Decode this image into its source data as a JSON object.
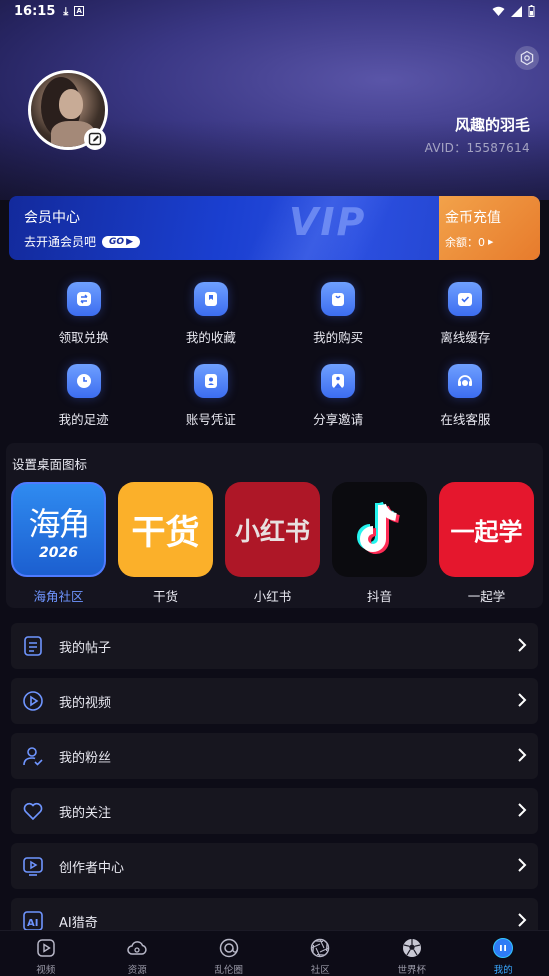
{
  "status_bar": {
    "time": "16:15"
  },
  "profile": {
    "nickname": "风趣的羽毛",
    "avid": "AVID：15587614"
  },
  "vip": {
    "title": "会员中心",
    "subtitle": "去开通会员吧",
    "go_label": "GO",
    "banner_word": "VIP"
  },
  "coins": {
    "title": "金币充值",
    "balance": "余额：0"
  },
  "functions": [
    {
      "label": "领取兑换",
      "icon": "exchange-icon"
    },
    {
      "label": "我的收藏",
      "icon": "bookmark-icon"
    },
    {
      "label": "我的购买",
      "icon": "shopping-bag-icon"
    },
    {
      "label": "离线缓存",
      "icon": "download-icon"
    },
    {
      "label": "我的足迹",
      "icon": "clock-icon"
    },
    {
      "label": "账号凭证",
      "icon": "id-card-icon"
    },
    {
      "label": "分享邀请",
      "icon": "share-icon"
    },
    {
      "label": "在线客服",
      "icon": "headset-icon"
    }
  ],
  "desktop_icons": {
    "title": "设置桌面图标",
    "apps": [
      {
        "label": "海角社区",
        "tile_text": "海角",
        "tile_sub": "2026",
        "selected": true
      },
      {
        "label": "干货",
        "tile_text": "干货",
        "selected": false
      },
      {
        "label": "小红书",
        "tile_text": "小红书",
        "selected": false
      },
      {
        "label": "抖音",
        "tile_text": "♪",
        "selected": false
      },
      {
        "label": "一起学",
        "tile_text": "一起学",
        "selected": false
      }
    ]
  },
  "menu": [
    {
      "label": "我的帖子",
      "icon": "document-icon"
    },
    {
      "label": "我的视频",
      "icon": "play-circle-icon"
    },
    {
      "label": "我的粉丝",
      "icon": "user-check-icon"
    },
    {
      "label": "我的关注",
      "icon": "heart-icon"
    },
    {
      "label": "创作者中心",
      "icon": "video-screen-icon"
    },
    {
      "label": "AI猎奇",
      "icon": "ai-icon"
    }
  ],
  "nav": [
    {
      "label": "视频",
      "icon": "video-icon",
      "active": false
    },
    {
      "label": "资源",
      "icon": "cloud-icon",
      "active": false
    },
    {
      "label": "乱伦圈",
      "icon": "circle-at-icon",
      "active": false
    },
    {
      "label": "社区",
      "icon": "aperture-icon",
      "active": false
    },
    {
      "label": "世界杯",
      "icon": "soccer-ball-icon",
      "active": false
    },
    {
      "label": "我的",
      "icon": "profile-icon",
      "active": true
    }
  ],
  "colors": {
    "accent": "#3a7bff",
    "coin": "#ec8a35",
    "active_nav": "#3aa8ff"
  }
}
